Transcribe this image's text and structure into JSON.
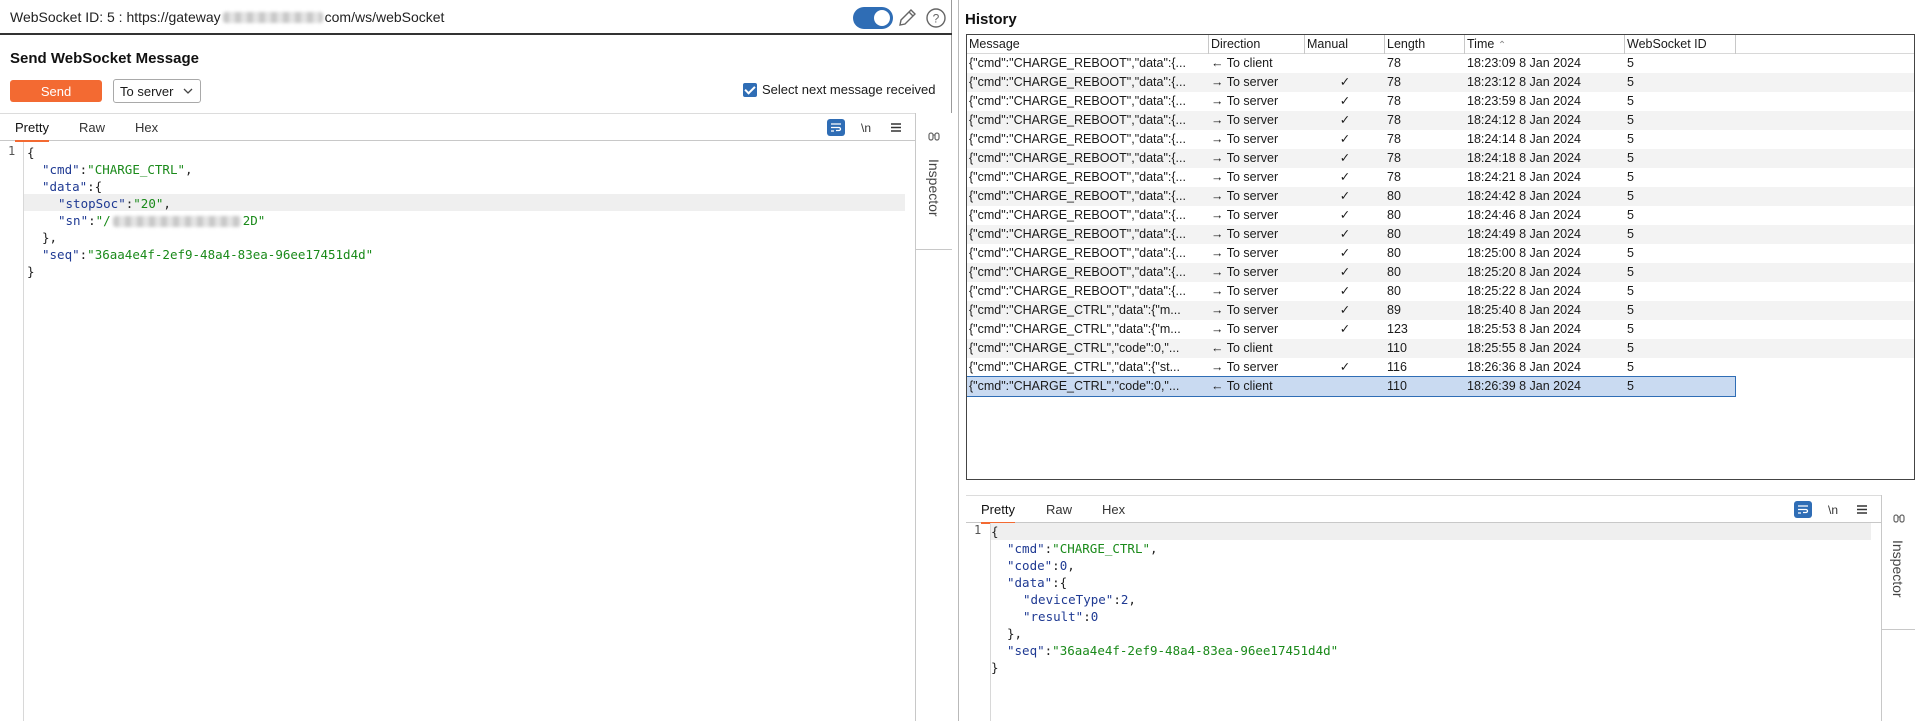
{
  "topbar": {
    "title_prefix": "WebSocket ID: 5 : https://gateway",
    "title_suffix": "com/ws/webSocket"
  },
  "send_panel": {
    "heading": "Send WebSocket Message",
    "send_label": "Send",
    "direction_value": "To server",
    "select_next_label": "Select next message received",
    "tabs": [
      "Pretty",
      "Raw",
      "Hex"
    ],
    "wrap_toggle": "\\n"
  },
  "editor": {
    "line_number": "1",
    "open": "{",
    "cmd_key": "\"cmd\"",
    "cmd_val": "\"CHARGE_CTRL\"",
    "data_key": "\"data\"",
    "stopsoc_key": "\"stopSoc\"",
    "stopsoc_val": "\"20\"",
    "sn_key": "\"sn\"",
    "sn_val_start": "\"/",
    "sn_val_end": "2D\"",
    "seq_key": "\"seq\"",
    "seq_val": "\"36aa4e4f-2ef9-48a4-83ea-96ee17451d4d\"",
    "close": "}"
  },
  "inspector_label": "Inspector",
  "history": {
    "title": "History",
    "columns": [
      "Message",
      "Direction",
      "Manual",
      "Length",
      "Time",
      "WebSocket ID"
    ],
    "sort_indicator": "^",
    "rows": [
      {
        "message": "{\"cmd\":\"CHARGE_REBOOT\",\"data\":{...",
        "direction": "← To client",
        "manual": "",
        "length": "78",
        "time": "18:23:09 8 Jan 2024",
        "ws_id": "5"
      },
      {
        "message": "{\"cmd\":\"CHARGE_REBOOT\",\"data\":{...",
        "direction": "→ To server",
        "manual": "✓",
        "length": "78",
        "time": "18:23:12 8 Jan 2024",
        "ws_id": "5"
      },
      {
        "message": "{\"cmd\":\"CHARGE_REBOOT\",\"data\":{...",
        "direction": "→ To server",
        "manual": "✓",
        "length": "78",
        "time": "18:23:59 8 Jan 2024",
        "ws_id": "5"
      },
      {
        "message": "{\"cmd\":\"CHARGE_REBOOT\",\"data\":{...",
        "direction": "→ To server",
        "manual": "✓",
        "length": "78",
        "time": "18:24:12 8 Jan 2024",
        "ws_id": "5"
      },
      {
        "message": "{\"cmd\":\"CHARGE_REBOOT\",\"data\":{...",
        "direction": "→ To server",
        "manual": "✓",
        "length": "78",
        "time": "18:24:14 8 Jan 2024",
        "ws_id": "5"
      },
      {
        "message": "{\"cmd\":\"CHARGE_REBOOT\",\"data\":{...",
        "direction": "→ To server",
        "manual": "✓",
        "length": "78",
        "time": "18:24:18 8 Jan 2024",
        "ws_id": "5"
      },
      {
        "message": "{\"cmd\":\"CHARGE_REBOOT\",\"data\":{...",
        "direction": "→ To server",
        "manual": "✓",
        "length": "78",
        "time": "18:24:21 8 Jan 2024",
        "ws_id": "5"
      },
      {
        "message": "{\"cmd\":\"CHARGE_REBOOT\",\"data\":{...",
        "direction": "→ To server",
        "manual": "✓",
        "length": "80",
        "time": "18:24:42 8 Jan 2024",
        "ws_id": "5"
      },
      {
        "message": "{\"cmd\":\"CHARGE_REBOOT\",\"data\":{...",
        "direction": "→ To server",
        "manual": "✓",
        "length": "80",
        "time": "18:24:46 8 Jan 2024",
        "ws_id": "5"
      },
      {
        "message": "{\"cmd\":\"CHARGE_REBOOT\",\"data\":{...",
        "direction": "→ To server",
        "manual": "✓",
        "length": "80",
        "time": "18:24:49 8 Jan 2024",
        "ws_id": "5"
      },
      {
        "message": "{\"cmd\":\"CHARGE_REBOOT\",\"data\":{...",
        "direction": "→ To server",
        "manual": "✓",
        "length": "80",
        "time": "18:25:00 8 Jan 2024",
        "ws_id": "5"
      },
      {
        "message": "{\"cmd\":\"CHARGE_REBOOT\",\"data\":{...",
        "direction": "→ To server",
        "manual": "✓",
        "length": "80",
        "time": "18:25:20 8 Jan 2024",
        "ws_id": "5"
      },
      {
        "message": "{\"cmd\":\"CHARGE_REBOOT\",\"data\":{...",
        "direction": "→ To server",
        "manual": "✓",
        "length": "80",
        "time": "18:25:22 8 Jan 2024",
        "ws_id": "5"
      },
      {
        "message": "{\"cmd\":\"CHARGE_CTRL\",\"data\":{\"m...",
        "direction": "→ To server",
        "manual": "✓",
        "length": "89",
        "time": "18:25:40 8 Jan 2024",
        "ws_id": "5"
      },
      {
        "message": "{\"cmd\":\"CHARGE_CTRL\",\"data\":{\"m...",
        "direction": "→ To server",
        "manual": "✓",
        "length": "123",
        "time": "18:25:53 8 Jan 2024",
        "ws_id": "5"
      },
      {
        "message": "{\"cmd\":\"CHARGE_CTRL\",\"code\":0,\"...",
        "direction": "← To client",
        "manual": "",
        "length": "110",
        "time": "18:25:55 8 Jan 2024",
        "ws_id": "5"
      },
      {
        "message": "{\"cmd\":\"CHARGE_CTRL\",\"data\":{\"st...",
        "direction": "→ To server",
        "manual": "✓",
        "length": "116",
        "time": "18:26:36 8 Jan 2024",
        "ws_id": "5"
      },
      {
        "message": "{\"cmd\":\"CHARGE_CTRL\",\"code\":0,\"...",
        "direction": "← To client",
        "manual": "",
        "length": "110",
        "time": "18:26:39 8 Jan 2024",
        "ws_id": "5"
      }
    ]
  },
  "viewer": {
    "tabs": [
      "Pretty",
      "Raw",
      "Hex"
    ],
    "line_number": "1",
    "open": "{",
    "cmd_key": "\"cmd\"",
    "cmd_val": "\"CHARGE_CTRL\"",
    "code_key": "\"code\"",
    "code_val": "0",
    "data_key": "\"data\"",
    "devicetype_key": "\"deviceType\"",
    "devicetype_val": "2",
    "result_key": "\"result\"",
    "result_val": "0",
    "seq_key": "\"seq\"",
    "seq_val": "\"36aa4e4f-2ef9-48a4-83ea-96ee17451d4d\"",
    "close": "}"
  },
  "colors": {
    "accent_orange": "#f36a32",
    "accent_blue": "#2f6db5",
    "selected_row": "#c9daf1"
  }
}
